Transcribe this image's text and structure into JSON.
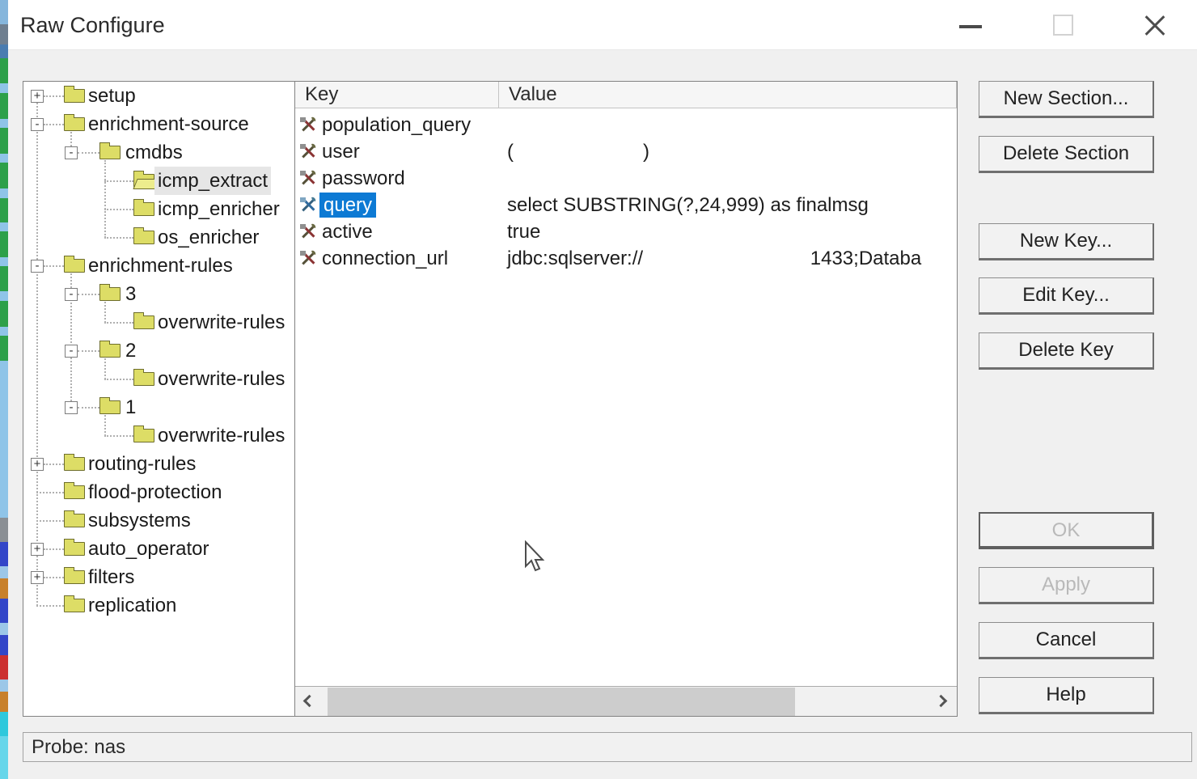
{
  "window": {
    "title": "Raw Configure"
  },
  "tree": {
    "items": [
      {
        "label": "setup",
        "level": 0,
        "expander": "+"
      },
      {
        "label": "enrichment-source",
        "level": 0,
        "expander": "-"
      },
      {
        "label": "cmdbs",
        "level": 1,
        "expander": "-"
      },
      {
        "label": "icmp_extract",
        "level": 2,
        "expander": "",
        "selected": true,
        "open_folder": true
      },
      {
        "label": "icmp_enricher",
        "level": 2,
        "expander": ""
      },
      {
        "label": "os_enricher",
        "level": 2,
        "expander": ""
      },
      {
        "label": "enrichment-rules",
        "level": 0,
        "expander": "-"
      },
      {
        "label": "3",
        "level": 1,
        "expander": "-"
      },
      {
        "label": "overwrite-rules",
        "level": 2,
        "expander": ""
      },
      {
        "label": "2",
        "level": 1,
        "expander": "-"
      },
      {
        "label": "overwrite-rules",
        "level": 2,
        "expander": ""
      },
      {
        "label": "1",
        "level": 1,
        "expander": "-"
      },
      {
        "label": "overwrite-rules",
        "level": 2,
        "expander": ""
      },
      {
        "label": "routing-rules",
        "level": 0,
        "expander": "+"
      },
      {
        "label": "flood-protection",
        "level": 0,
        "expander": ""
      },
      {
        "label": "subsystems",
        "level": 0,
        "expander": ""
      },
      {
        "label": "auto_operator",
        "level": 0,
        "expander": "+"
      },
      {
        "label": "filters",
        "level": 0,
        "expander": "+"
      },
      {
        "label": "replication",
        "level": 0,
        "expander": ""
      }
    ]
  },
  "table": {
    "columns": {
      "key": "Key",
      "value": "Value"
    },
    "rows": [
      {
        "key": "population_query",
        "value": ""
      },
      {
        "key": "user",
        "value": "(                        )"
      },
      {
        "key": "password",
        "value": ""
      },
      {
        "key": "query",
        "value": "select SUBSTRING(?,24,999) as finalmsg",
        "selected": true
      },
      {
        "key": "active",
        "value": "true"
      },
      {
        "key": "connection_url",
        "value": "jdbc:sqlserver://                               1433;Databa"
      }
    ]
  },
  "buttons": {
    "new_section": "New Section...",
    "delete_section": "Delete Section",
    "new_key": "New Key...",
    "edit_key": "Edit Key...",
    "delete_key": "Delete Key",
    "ok": "OK",
    "apply": "Apply",
    "cancel": "Cancel",
    "help": "Help",
    "ok_disabled": true,
    "apply_disabled": true
  },
  "status": {
    "text": "Probe: nas"
  },
  "colors": {
    "selection_blue": "#0d7ad4",
    "folder_yellow": "#dddd66",
    "titlebar_bg": "#ffffff",
    "body_bg": "#f0f0f0"
  },
  "edge_strip": [
    [
      30,
      "#86b6dc"
    ],
    [
      25,
      "#6f7f90"
    ],
    [
      17,
      "#4a7cb0"
    ],
    [
      31,
      "#2da04a"
    ],
    [
      12,
      "#8fc4e8"
    ],
    [
      32,
      "#2da04a"
    ],
    [
      11,
      "#8fc4e8"
    ],
    [
      32,
      "#2da04a"
    ],
    [
      11,
      "#8fc4e8"
    ],
    [
      32,
      "#2da04a"
    ],
    [
      12,
      "#8fc4e8"
    ],
    [
      30,
      "#2da04a"
    ],
    [
      11,
      "#8fc4e8"
    ],
    [
      32,
      "#2da04a"
    ],
    [
      11,
      "#8fc4e8"
    ],
    [
      31,
      "#2da04a"
    ],
    [
      12,
      "#8fc4e8"
    ],
    [
      32,
      "#2da04a"
    ],
    [
      11,
      "#8fc4e8"
    ],
    [
      31,
      "#2da04a"
    ],
    [
      194,
      "#8fc4e8"
    ],
    [
      30,
      "#8a8f94"
    ],
    [
      30,
      "#3346c8"
    ],
    [
      15,
      "#9cc7e8"
    ],
    [
      25,
      "#c8802b"
    ],
    [
      30,
      "#3346c8"
    ],
    [
      15,
      "#9cc7e8"
    ],
    [
      25,
      "#3346c8"
    ],
    [
      30,
      "#cc3030"
    ],
    [
      15,
      "#9cc7e8"
    ],
    [
      25,
      "#c8802b"
    ],
    [
      30,
      "#2ec8dc"
    ],
    [
      53,
      "#66d6ea"
    ]
  ]
}
